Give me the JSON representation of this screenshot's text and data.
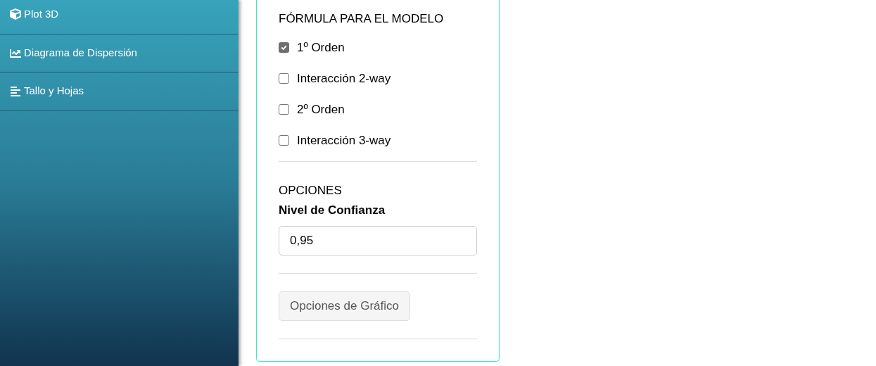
{
  "sidebar": {
    "items": [
      {
        "label": "Plot 3D",
        "kind": "cube"
      },
      {
        "label": "Diagrama de Dispersión",
        "kind": "chart"
      },
      {
        "label": "Tallo y Hojas",
        "kind": "lines"
      }
    ]
  },
  "formula": {
    "title": "FÓRMULA PARA EL MODELO",
    "options": [
      {
        "label": "1º Orden",
        "checked": true
      },
      {
        "label": "Interacción 2-way",
        "checked": false
      },
      {
        "label": "2º Orden",
        "checked": false
      },
      {
        "label": "Interacción 3-way",
        "checked": false
      }
    ]
  },
  "options": {
    "title": "OPCIONES",
    "field_label": "Nivel de Confianza",
    "value": "0,95"
  },
  "chart_options_button": {
    "label": "Opciones de Gráfico",
    "disabled": true
  }
}
